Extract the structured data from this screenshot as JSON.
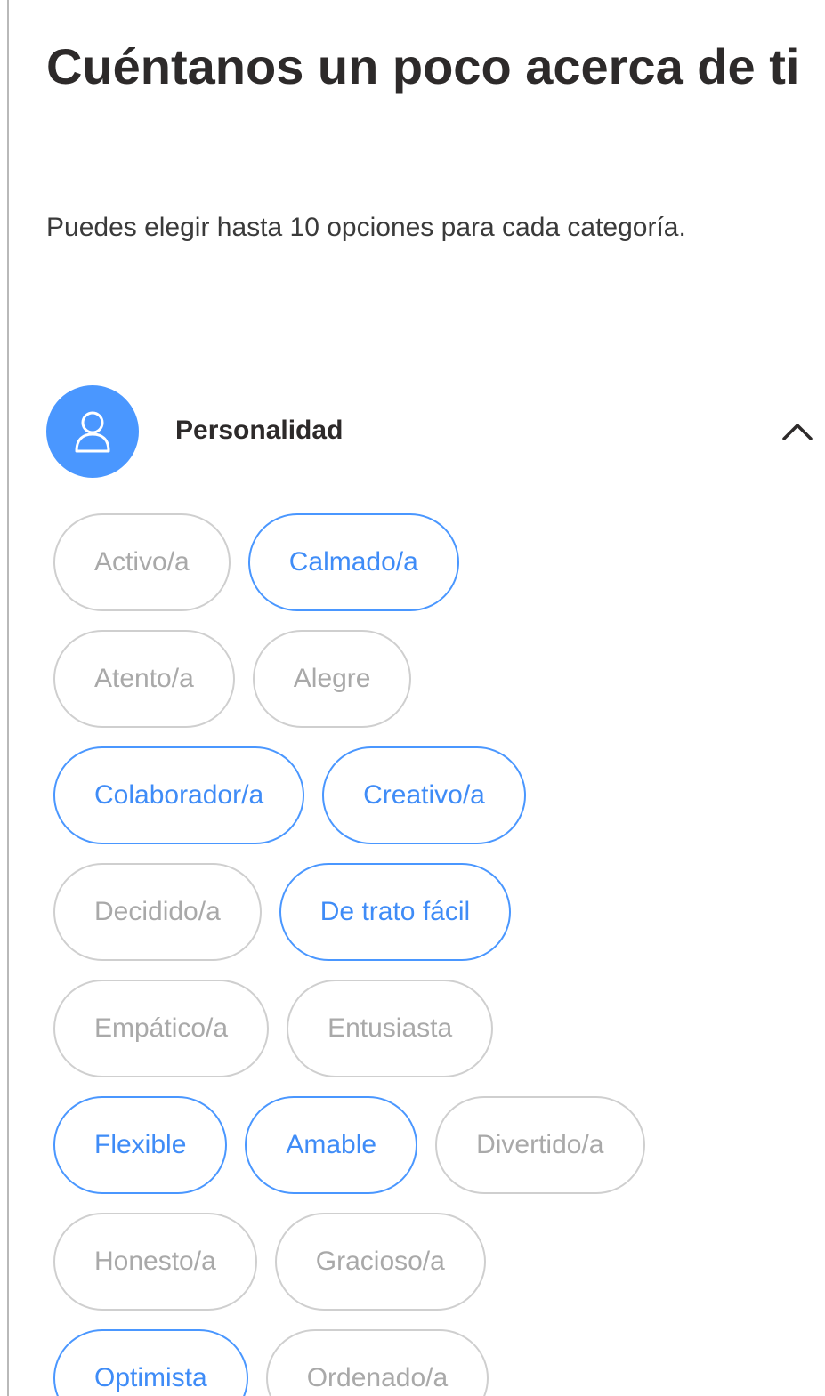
{
  "title": "Cuéntanos un poco acerca de ti",
  "subtitle": "Puedes elegir hasta 10 opciones para cada categoría.",
  "category": {
    "title": "Personalidad",
    "icon": "person-icon",
    "toggle_icon": "chevron-up-icon",
    "expanded": true,
    "icon_color": "#4a97ff"
  },
  "selected_color": "#4a97ff",
  "options": [
    {
      "label": "Activo/a",
      "selected": false
    },
    {
      "label": "Calmado/a",
      "selected": true
    },
    {
      "label": "Atento/a",
      "selected": false
    },
    {
      "label": "Alegre",
      "selected": false
    },
    {
      "label": "Colaborador/a",
      "selected": true
    },
    {
      "label": "Creativo/a",
      "selected": true
    },
    {
      "label": "Decidido/a",
      "selected": false
    },
    {
      "label": "De trato fácil",
      "selected": true
    },
    {
      "label": "Empático/a",
      "selected": false
    },
    {
      "label": "Entusiasta",
      "selected": false
    },
    {
      "label": "Flexible",
      "selected": true
    },
    {
      "label": "Amable",
      "selected": true
    },
    {
      "label": "Divertido/a",
      "selected": false
    },
    {
      "label": "Honesto/a",
      "selected": false
    },
    {
      "label": "Gracioso/a",
      "selected": false
    },
    {
      "label": "Optimista",
      "selected": true
    },
    {
      "label": "Ordenado/a",
      "selected": false
    }
  ]
}
